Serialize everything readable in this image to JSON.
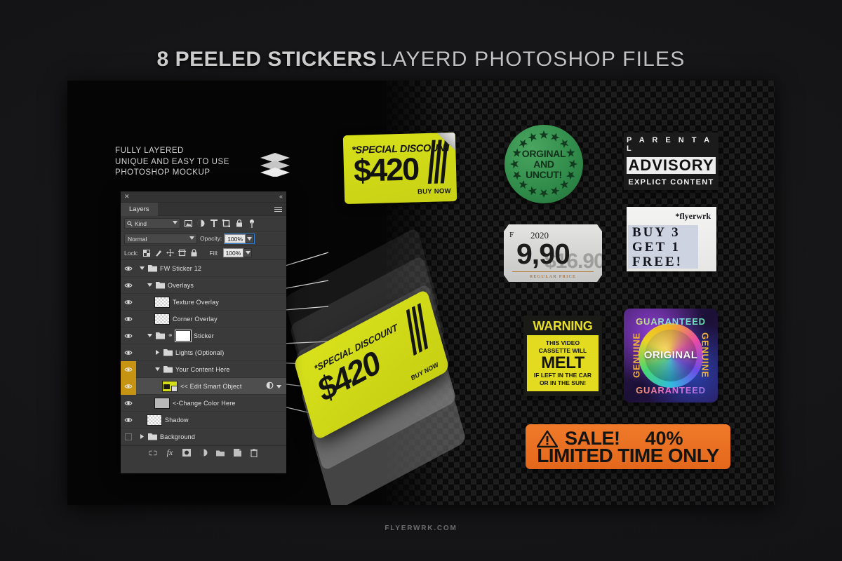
{
  "header": {
    "title_bold": "8 PEELED STICKERS",
    "title_light": "LAYERD PHOTOSHOP FILES"
  },
  "info": {
    "line1": "FULLY LAYERED",
    "line2": "UNIQUE AND EASY TO USE",
    "line3": "PHOTOSHOP MOCKUP"
  },
  "panel": {
    "tab_label": "Layers",
    "close_glyph": "✕",
    "collapse_glyph": "«",
    "filter": {
      "kind_label": "Kind",
      "search_icon": "search-icon",
      "icons": [
        "pixel-layer-icon",
        "adjustment-layer-icon",
        "type-layer-icon",
        "shape-layer-icon",
        "smart-object-icon",
        "filter-toggle-icon"
      ]
    },
    "blend": {
      "mode": "Normal",
      "opacity_label": "Opacity:",
      "opacity_value": "100%"
    },
    "lock": {
      "label": "Lock:",
      "icons": [
        "lock-transparent-icon",
        "lock-image-icon",
        "lock-position-icon",
        "lock-artboard-icon",
        "lock-all-icon"
      ],
      "fill_label": "Fill:",
      "fill_value": "100%"
    },
    "layers": [
      {
        "name": "FW Sticker 12",
        "type": "group",
        "indent": 0,
        "expanded": true,
        "visible": true,
        "selected": false,
        "eye_highlight": false,
        "thumb": "none"
      },
      {
        "name": "Overlays",
        "type": "group",
        "indent": 1,
        "expanded": true,
        "visible": true,
        "selected": false,
        "eye_highlight": false,
        "thumb": "none"
      },
      {
        "name": "Texture Overlay",
        "type": "layer",
        "indent": 2,
        "expanded": null,
        "visible": true,
        "selected": false,
        "eye_highlight": false,
        "thumb": "checker"
      },
      {
        "name": "Corner Overlay",
        "type": "layer",
        "indent": 2,
        "expanded": null,
        "visible": true,
        "selected": false,
        "eye_highlight": false,
        "thumb": "checker"
      },
      {
        "name": "Sticker",
        "type": "group",
        "indent": 1,
        "expanded": true,
        "visible": true,
        "selected": false,
        "eye_highlight": false,
        "thumb": "white-mask"
      },
      {
        "name": "Lights (Optional)",
        "type": "group",
        "indent": 2,
        "expanded": false,
        "visible": true,
        "selected": false,
        "eye_highlight": false,
        "thumb": "none"
      },
      {
        "name": "Your Content Here",
        "type": "group",
        "indent": 2,
        "expanded": true,
        "visible": true,
        "selected": false,
        "eye_highlight": true,
        "thumb": "none"
      },
      {
        "name": "<< Edit Smart Object",
        "type": "smart",
        "indent": 3,
        "expanded": null,
        "visible": true,
        "selected": true,
        "eye_highlight": true,
        "thumb": "yellow-sticker"
      },
      {
        "name": "<-Change Color Here",
        "type": "layer",
        "indent": 2,
        "expanded": null,
        "visible": true,
        "selected": false,
        "eye_highlight": false,
        "thumb": "grey"
      },
      {
        "name": "Shadow",
        "type": "layer",
        "indent": 1,
        "expanded": null,
        "visible": true,
        "selected": false,
        "eye_highlight": false,
        "thumb": "checker"
      },
      {
        "name": "Background",
        "type": "group",
        "indent": 0,
        "expanded": false,
        "visible": false,
        "selected": false,
        "eye_highlight": false,
        "thumb": "none"
      }
    ],
    "bottom_icons": [
      "link-layers-icon",
      "layer-style-fx-icon",
      "layer-mask-icon",
      "adjustment-layer-icon",
      "new-group-icon",
      "new-layer-icon",
      "delete-layer-icon"
    ],
    "fx_label": "fx"
  },
  "stickers": {
    "yellow_discount": {
      "name": "special-discount-sticker",
      "headline": "*SPECIAL DISCOUNT",
      "price": "$420",
      "cta": "BUY NOW",
      "color": "#d4dd19"
    },
    "green_circle": {
      "name": "orginal-and-uncut-sticker",
      "line1": "ORGINAL",
      "line2": "AND",
      "line3": "UNCUT!",
      "color": "#2f8a49"
    },
    "parental": {
      "name": "parental-advisory-sticker",
      "line1": "P A R E N T A L",
      "line2": "ADVISORY",
      "line3": "EXPLICT CONTENT",
      "color": "#1b1b1b"
    },
    "price_tag": {
      "name": "regular-price-tag-sticker",
      "code": "F",
      "year": "2020",
      "price": "9,90",
      "old_price": "$16.90",
      "footer": "REGULAR PRICE",
      "color": "#d6d6d4"
    },
    "buy_get_free": {
      "name": "buy-3-get-1-free-sticker",
      "brand": "*flyerwrk",
      "line1": "BUY 3",
      "line2": "GET 1",
      "line3": "FREE!",
      "color": "#eeeeec"
    },
    "warning": {
      "name": "warning-melt-sticker",
      "title": "WARNING",
      "line1": "THIS VIDEO",
      "line2": "CASSETTE WILL",
      "big": "MELT",
      "line3": "IF LEFT IN THE CAR",
      "line4": "OR IN THE SUN!",
      "color": "#e2db1f"
    },
    "holographic": {
      "name": "genuine-original-hologram-sticker",
      "top": "GUARANTEED",
      "bottom": "GUARANTEED",
      "left": "GENUINE",
      "right": "GENUINE",
      "center": "ORIGINAL"
    },
    "sale": {
      "name": "sale-limited-time-sticker",
      "warning_icon": "warning-triangle-icon",
      "line1a": "SALE!",
      "line1b": "40%",
      "line2": "LIMITED TIME ONLY",
      "color": "#e86f1f"
    },
    "yellow_tilted": {
      "name": "special-discount-sticker-tilted",
      "headline": "*SPECIAL DISCOUNT",
      "price": "$420",
      "cta": "BUY NOW"
    }
  },
  "footer": {
    "text": "FLYERWRK.COM"
  }
}
